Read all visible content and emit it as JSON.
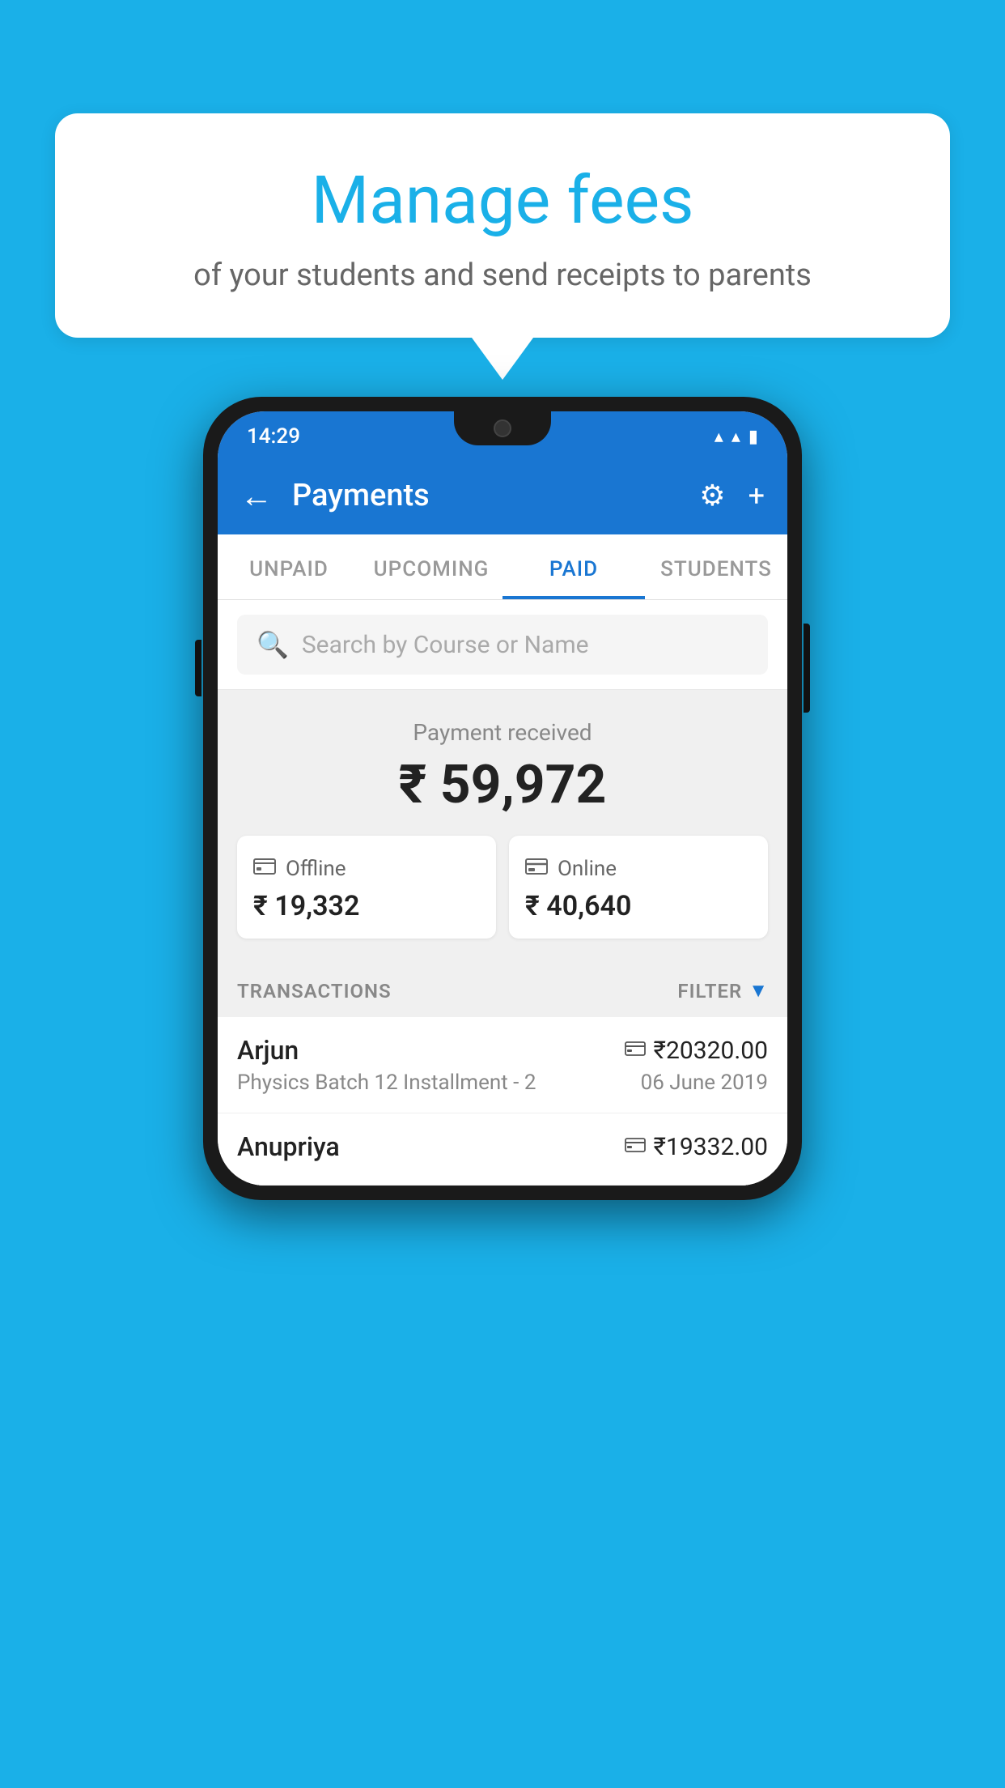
{
  "background_color": "#1ab0e8",
  "speech_bubble": {
    "title": "Manage fees",
    "subtitle": "of your students and send receipts to parents"
  },
  "status_bar": {
    "time": "14:29",
    "wifi": "▲",
    "signal": "▲",
    "battery": "▉"
  },
  "app_bar": {
    "title": "Payments",
    "back_label": "←",
    "gear_label": "⚙",
    "plus_label": "+"
  },
  "tabs": [
    {
      "label": "UNPAID",
      "active": false
    },
    {
      "label": "UPCOMING",
      "active": false
    },
    {
      "label": "PAID",
      "active": true
    },
    {
      "label": "STUDENTS",
      "active": false
    }
  ],
  "search": {
    "placeholder": "Search by Course or Name"
  },
  "payment_summary": {
    "label": "Payment received",
    "total": "₹ 59,972",
    "offline": {
      "type": "Offline",
      "amount": "₹ 19,332",
      "icon": "💳"
    },
    "online": {
      "type": "Online",
      "amount": "₹ 40,640",
      "icon": "💳"
    }
  },
  "transactions": {
    "label": "TRANSACTIONS",
    "filter_label": "FILTER",
    "items": [
      {
        "name": "Arjun",
        "amount": "₹20320.00",
        "course": "Physics Batch 12 Installment - 2",
        "date": "06 June 2019",
        "payment_type": "online"
      },
      {
        "name": "Anupriya",
        "amount": "₹19332.00",
        "course": "",
        "date": "",
        "payment_type": "offline"
      }
    ]
  }
}
